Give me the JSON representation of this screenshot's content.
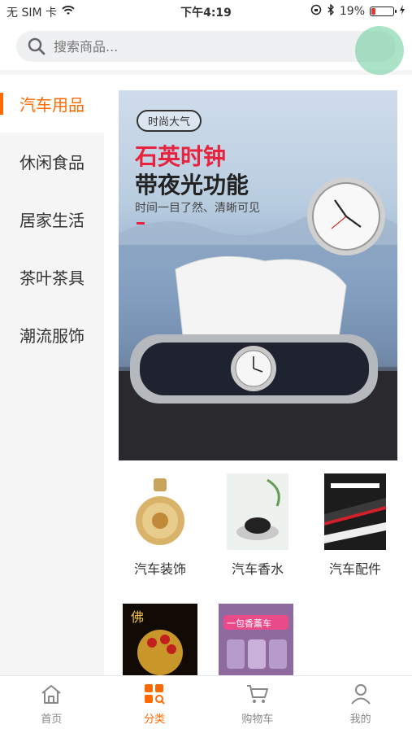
{
  "status_bar": {
    "carrier": "无 SIM 卡",
    "time": "下午4:19",
    "battery": "19%",
    "battery_level": 0.19
  },
  "search": {
    "placeholder": "搜索商品..."
  },
  "sidebar": {
    "items": [
      {
        "label": "汽车用品",
        "active": true
      },
      {
        "label": "休闲食品",
        "active": false
      },
      {
        "label": "居家生活",
        "active": false
      },
      {
        "label": "茶叶茶具",
        "active": false
      },
      {
        "label": "潮流服饰",
        "active": false
      }
    ]
  },
  "banner": {
    "tag": "时尚大气",
    "headline_red": "石英时钟",
    "headline_black": "带夜光功能",
    "subline": "时间一目了然、清晰可见"
  },
  "categories": [
    {
      "label": "汽车装饰"
    },
    {
      "label": "汽车香水"
    },
    {
      "label": "汽车配件"
    }
  ],
  "more_thumbs": [
    {
      "text": "佛"
    },
    {
      "text": "一包香薰车"
    }
  ],
  "tabbar": {
    "items": [
      {
        "label": "首页",
        "active": false
      },
      {
        "label": "分类",
        "active": true
      },
      {
        "label": "购物车",
        "active": false
      },
      {
        "label": "我的",
        "active": false
      }
    ]
  },
  "colors": {
    "accent": "#ff6a00",
    "banner_red": "#e8233d"
  }
}
